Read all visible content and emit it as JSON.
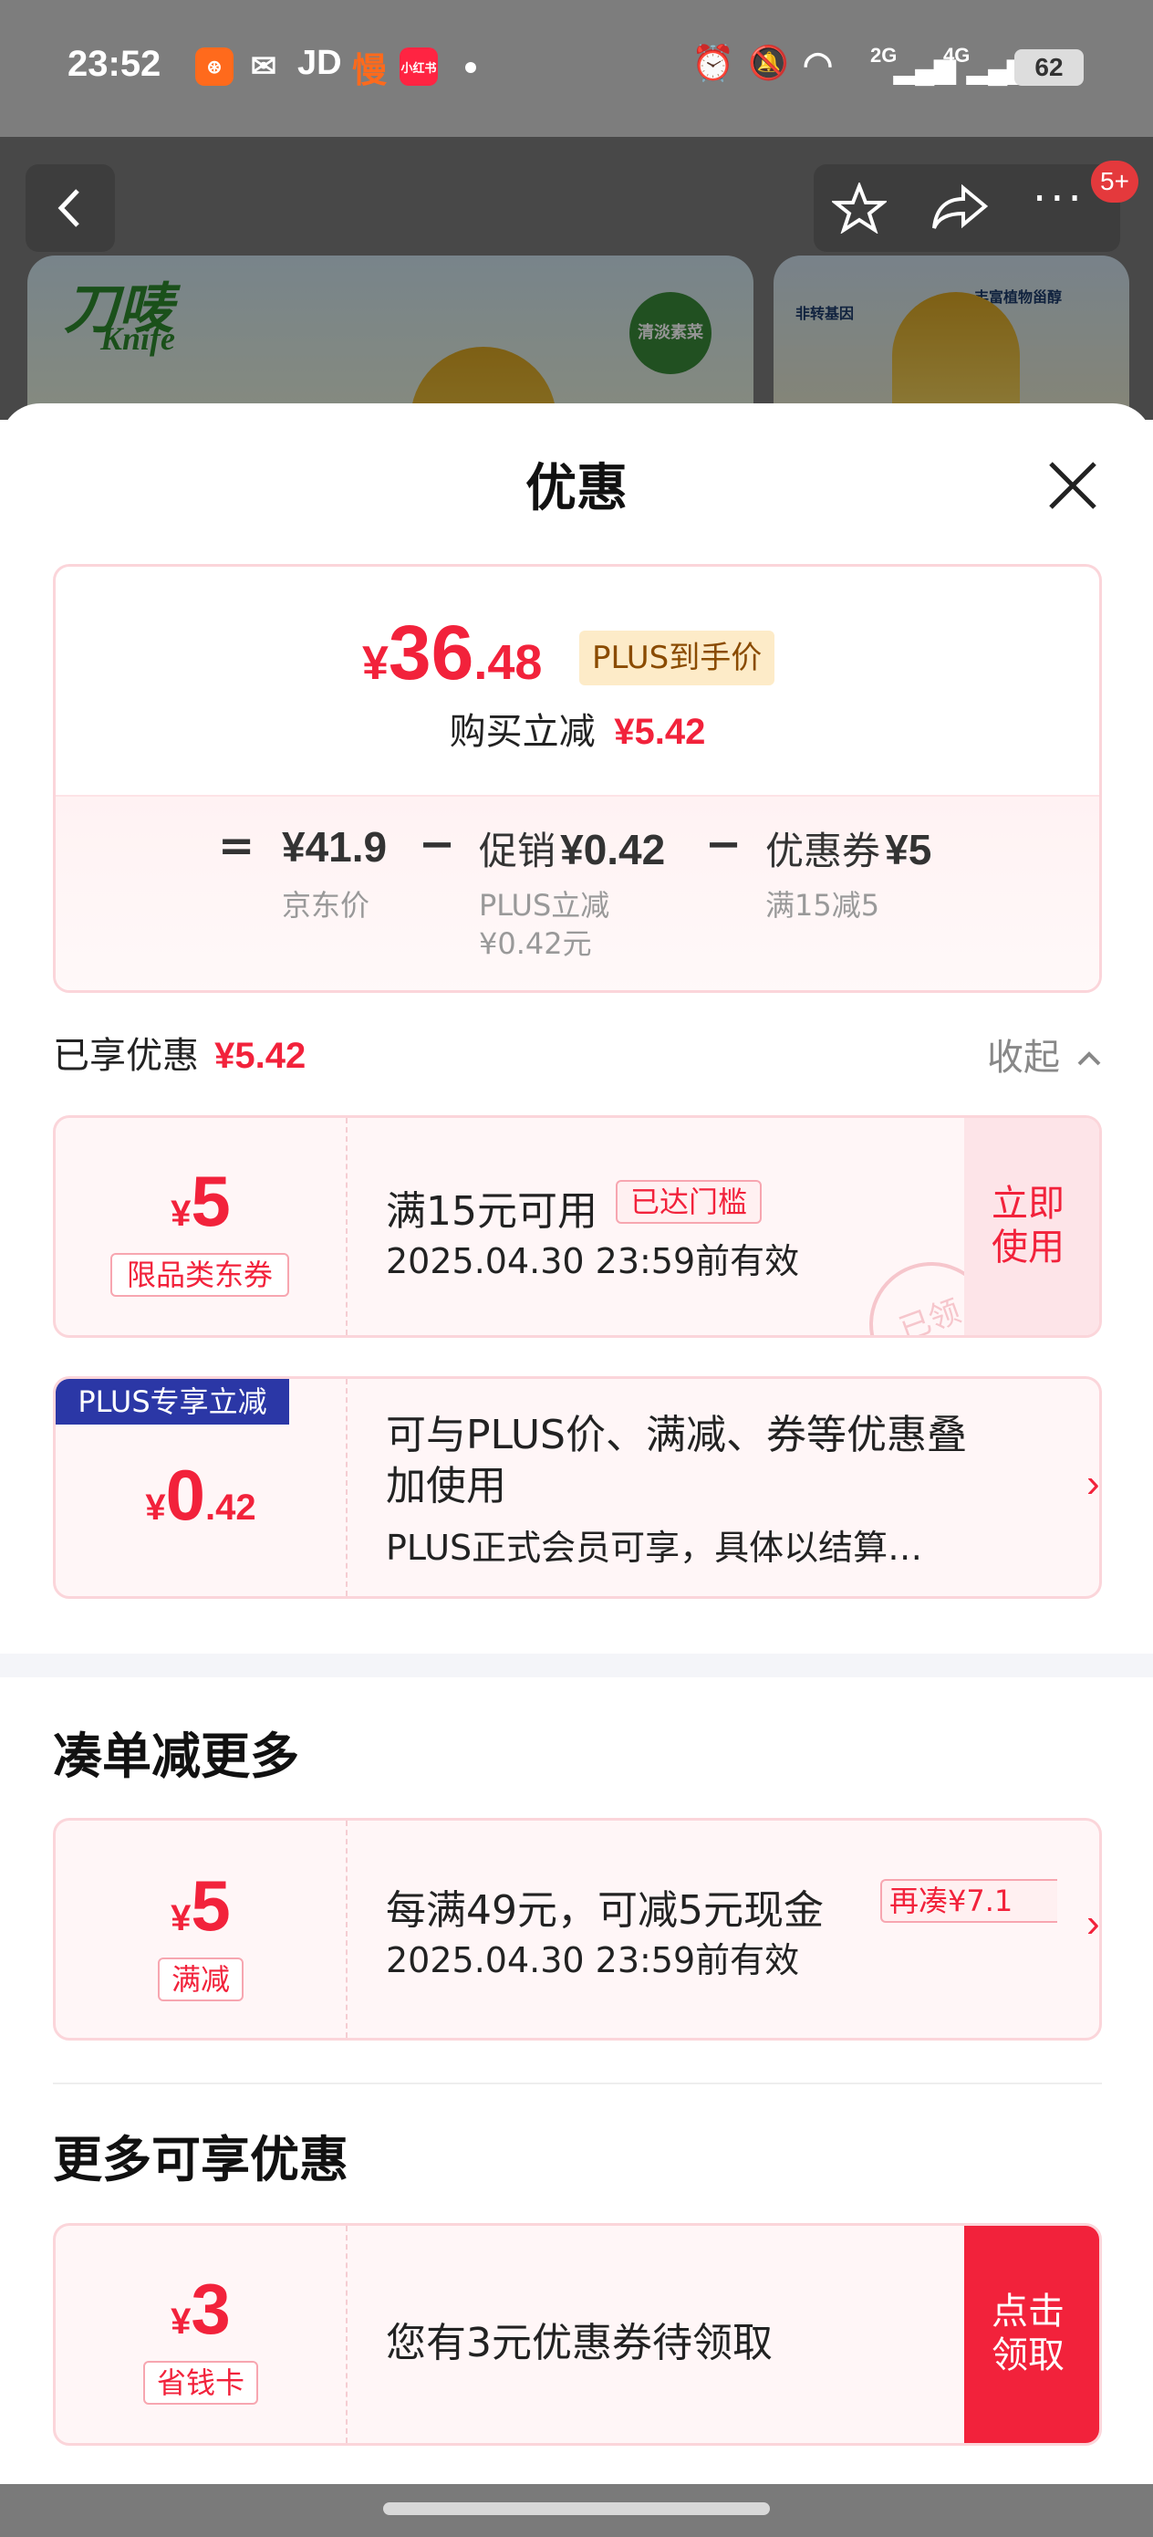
{
  "status_bar": {
    "time": "23:52",
    "apps": [
      "快手",
      "微信",
      "JD",
      "慢",
      "小红书"
    ],
    "network": [
      "2G",
      "4G"
    ],
    "battery": "62"
  },
  "background": {
    "brand": "刀唛",
    "brand_en": "Knife",
    "cart_badge": "5+",
    "banner_tag": "清淡素菜",
    "banner2_point1": "非转基因",
    "banner2_point2": "丰富植物甾醇"
  },
  "sheet": {
    "title": "优惠"
  },
  "price_summary": {
    "currency": "¥",
    "price_int": "36",
    "price_dec": ".48",
    "price_tag": "PLUS到手价",
    "save_label": "购买立减",
    "save_value": "¥5.42",
    "eq": "=",
    "minus": "−",
    "jd_price": "¥41.9",
    "jd_price_label": "京东价",
    "promo_label": "促销",
    "promo_value": "¥0.42",
    "promo_sub1": "PLUS立减",
    "promo_sub2": "¥0.42元",
    "coupon_label": "优惠券",
    "coupon_value": "¥5",
    "coupon_sub": "满15减5"
  },
  "enjoyed": {
    "label": "已享优惠",
    "value": "¥5.42",
    "collapse": "收起"
  },
  "coupons": [
    {
      "currency": "¥",
      "amount": "5",
      "tag": "限品类东券",
      "title": "满15元可用",
      "status": "已达门槛",
      "validity": "2025.04.30 23:59前有效",
      "action": "立即使用",
      "stamp": "已领"
    },
    {
      "ribbon": "PLUS专享立减",
      "currency": "¥",
      "amount_int": "0",
      "amount_dec": ".42",
      "title": "可与PLUS价、满减、券等优惠叠加使用",
      "desc": "PLUS正式会员可享，具体以结算…"
    }
  ],
  "more_deals": {
    "title": "凑单减更多",
    "card": {
      "currency": "¥",
      "amount": "5",
      "tag": "满减",
      "title": "每满49元，可减5元现金",
      "status": "再凑¥7.1",
      "validity": "2025.04.30 23:59前有效"
    }
  },
  "more_offers": {
    "title": "更多可享优惠",
    "card": {
      "currency": "¥",
      "amount": "3",
      "tag": "省钱卡",
      "title": "您有3元优惠券待领取",
      "action": "点击领取"
    }
  },
  "colors": {
    "accent_red": "#f2223b",
    "card_bg": "#fff6f7",
    "plus_ribbon": "#2b37a6",
    "plus_tag_bg": "#fdebc8"
  }
}
